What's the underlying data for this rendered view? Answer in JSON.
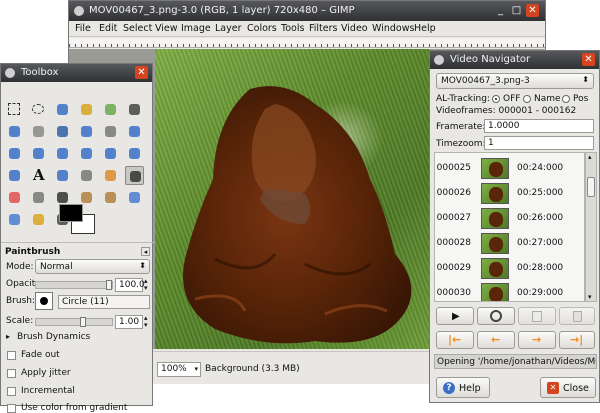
{
  "gimp": {
    "title": "MOV00467_3.png-3.0 (RGB, 1 layer) 720x480 – GIMP",
    "menu": [
      "File",
      "Edit",
      "Select",
      "View",
      "Image",
      "Layer",
      "Colors",
      "Tools",
      "Filters",
      "Video",
      "Windows",
      "Help"
    ],
    "zoom": "100%",
    "status": "Background (3.3 MB)"
  },
  "toolbox": {
    "title": "Toolbox",
    "tool_icons": [
      "rect-select-icon",
      "ellipse-select-icon",
      "free-select-icon",
      "fuzzy-select-icon",
      "color-select-icon",
      "scissors-icon",
      "foreground-select-icon",
      "paths-icon",
      "color-picker-icon",
      "zoom-icon",
      "measure-icon",
      "move-icon",
      "align-icon",
      "crop-icon",
      "rotate-icon",
      "scale-icon",
      "shear-icon",
      "perspective-icon",
      "flip-icon",
      "text-icon",
      "bucket-fill-icon",
      "blend-icon",
      "pencil-icon",
      "paintbrush-icon",
      "eraser-icon",
      "airbrush-icon",
      "ink-icon",
      "clone-icon",
      "heal-icon",
      "perspective-clone-icon",
      "blur-icon",
      "smudge-icon",
      "dodge-burn-icon"
    ],
    "options_title": "Paintbrush",
    "mode_label": "Mode:",
    "mode_value": "Normal",
    "opacity_label": "Opacity",
    "opacity_value": "100.0",
    "brush_label": "Brush:",
    "brush_value": "Circle (11)",
    "scale_label": "Scale:",
    "scale_value": "1.00",
    "dynamics_label": "Brush Dynamics",
    "fade_out": "Fade out",
    "apply_jitter": "Apply jitter",
    "incremental": "Incremental",
    "use_color": "Use color from gradient"
  },
  "navigator": {
    "title": "Video Navigator",
    "image_select": "MOV00467_3.png-3",
    "ai_tracking_label": "AL-Tracking:",
    "radio_off": "OFF",
    "radio_name": "Name",
    "radio_pos": "Pos",
    "videoframes": "Videoframes: 000001 - 000162",
    "framerate_label": "Framerate:",
    "framerate_value": "1.0000",
    "timezoom_label": "Timezoom:",
    "timezoom_value": "1",
    "frames": [
      {
        "num": "000025",
        "time": "00:24:000"
      },
      {
        "num": "000026",
        "time": "00:25:000"
      },
      {
        "num": "000027",
        "time": "00:26:000"
      },
      {
        "num": "000028",
        "time": "00:27:000"
      },
      {
        "num": "000029",
        "time": "00:28:000"
      },
      {
        "num": "000030",
        "time": "00:29:000"
      }
    ],
    "status": "Opening '/home/jonathan/Videos/MOV...",
    "help_label": "Help",
    "close_label": "Close"
  },
  "colors": {
    "titlebar": "#3e3f42",
    "close": "#d4441f",
    "arrow": "#f08a1c"
  }
}
